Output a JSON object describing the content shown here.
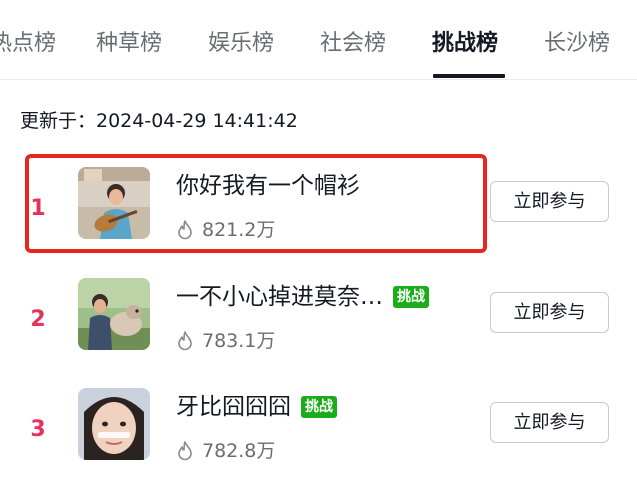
{
  "tabs": [
    {
      "label": "热点榜"
    },
    {
      "label": "种草榜"
    },
    {
      "label": "娱乐榜"
    },
    {
      "label": "社会榜"
    },
    {
      "label": "挑战榜",
      "active": true
    },
    {
      "label": "长沙榜"
    }
  ],
  "updated": {
    "text": "更新于：2024-04-29 14:41:42"
  },
  "items": [
    {
      "rank": "1",
      "title": "你好我有一个帽衫",
      "badge": "",
      "heat": "821.2万",
      "button": "立即参与"
    },
    {
      "rank": "2",
      "title": "一不小心掉进莫奈…",
      "badge": "挑战",
      "heat": "783.1万",
      "button": "立即参与"
    },
    {
      "rank": "3",
      "title": "牙比囧囧囧",
      "badge": "挑战",
      "heat": "782.8万",
      "button": "立即参与"
    }
  ],
  "colors": {
    "rank": "#e5325a",
    "badge": "#1aad19",
    "highlight": "#e8261e",
    "secondary_text": "#6b6d73"
  },
  "icons": {
    "heat": "flame-icon"
  }
}
